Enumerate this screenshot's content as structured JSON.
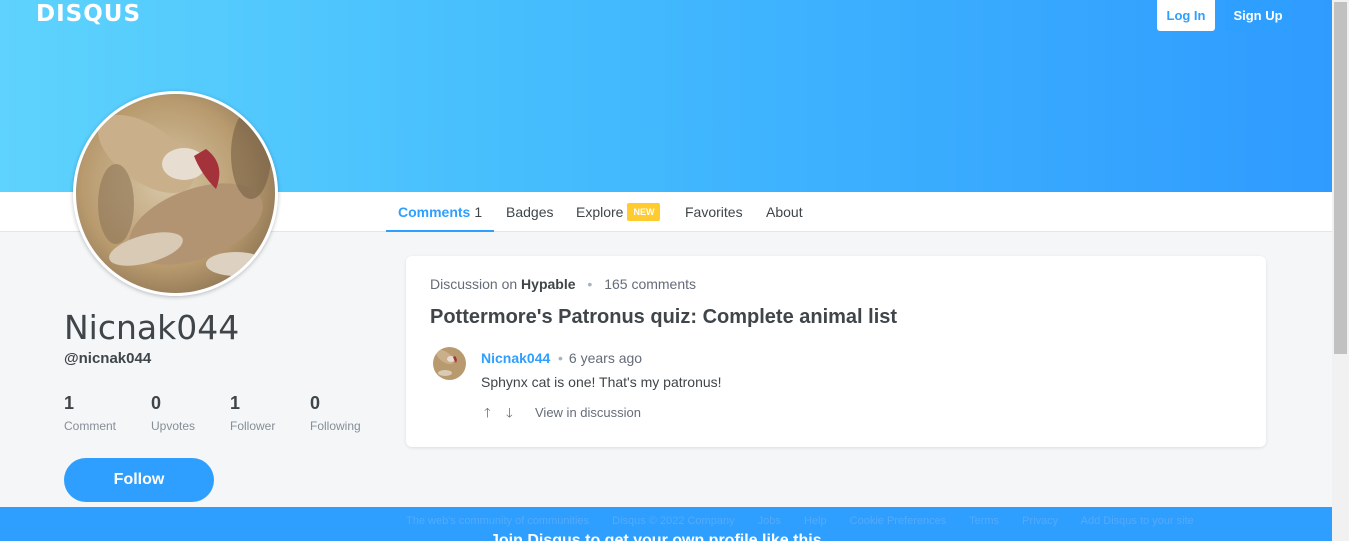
{
  "header": {
    "logo": "DISQUS",
    "login_label": "Log In",
    "signup_label": "Sign Up"
  },
  "tabs": [
    {
      "label": "Comments",
      "count": "1"
    },
    {
      "label": "Badges"
    },
    {
      "label": "Explore",
      "badge": "NEW"
    },
    {
      "label": "Favorites"
    },
    {
      "label": "About"
    }
  ],
  "profile": {
    "name": "Nicnak044",
    "handle": "@nicnak044",
    "stats": [
      {
        "value": "1",
        "label": "Comment"
      },
      {
        "value": "0",
        "label": "Upvotes"
      },
      {
        "value": "1",
        "label": "Follower"
      },
      {
        "value": "0",
        "label": "Following"
      }
    ],
    "follow_label": "Follow",
    "more_label": "···"
  },
  "comment_card": {
    "discussion_prefix": "Discussion on",
    "forum": "Hypable",
    "comments_count": "165 comments",
    "thread_title": "Pottermore's Patronus quiz: Complete animal list",
    "author": "Nicnak044",
    "time": "6 years ago",
    "text": "Sphynx cat is one! That's my patronus!",
    "view_link": "View in discussion"
  },
  "footer": {
    "links": [
      "The web's community of communities",
      "Disqus © 2022 Company",
      "Jobs",
      "Help",
      "Cookie Preferences",
      "Terms",
      "Privacy",
      "Add Disqus to your site"
    ],
    "cta": "Join Disqus to get your own profile like this"
  },
  "colors": {
    "accent": "#2e9fff",
    "badge_new": "#ffcb2f"
  }
}
